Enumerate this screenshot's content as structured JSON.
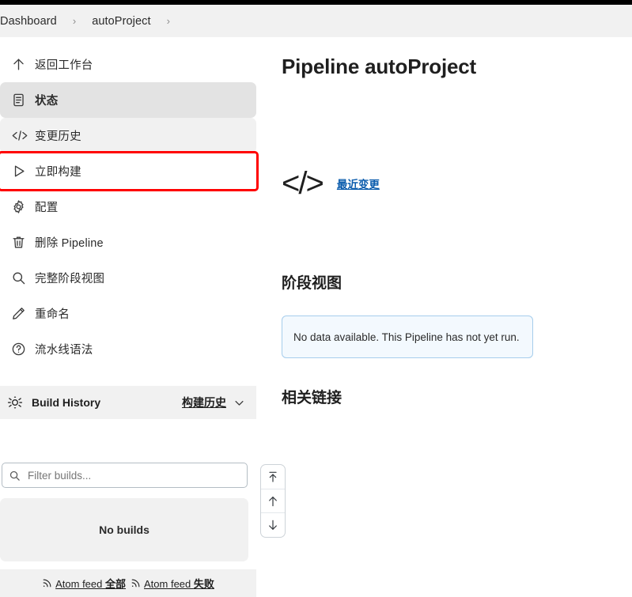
{
  "breadcrumb": {
    "items": [
      {
        "label": "Dashboard"
      },
      {
        "label": "autoProject"
      }
    ],
    "separator": "›"
  },
  "sidebar": {
    "nav_items": [
      {
        "label": "返回工作台",
        "icon": "arrow-up-icon",
        "state": "normal"
      },
      {
        "label": "状态",
        "icon": "document-icon",
        "state": "active"
      },
      {
        "label": "变更历史",
        "icon": "code-icon",
        "state": "soft"
      },
      {
        "label": "立即构建",
        "icon": "play-icon",
        "state": "highlighted"
      },
      {
        "label": "配置",
        "icon": "gear-icon",
        "state": "normal"
      },
      {
        "label": "删除 Pipeline",
        "icon": "trash-icon",
        "state": "normal"
      },
      {
        "label": "完整阶段视图",
        "icon": "search-icon",
        "state": "normal"
      },
      {
        "label": "重命名",
        "icon": "pencil-icon",
        "state": "normal"
      },
      {
        "label": "流水线语法",
        "icon": "question-circle-icon",
        "state": "normal"
      }
    ],
    "build_history": {
      "icon": "build-history-icon",
      "title": "Build History",
      "link_label": "构建历史",
      "chevron": "chevron-down-icon"
    },
    "filter": {
      "icon": "search-icon",
      "placeholder": "Filter builds...",
      "value": ""
    },
    "no_builds_label": "No builds",
    "feeds": [
      {
        "icon": "rss-icon",
        "prefix": "Atom feed ",
        "suffix": "全部"
      },
      {
        "icon": "rss-icon",
        "prefix": "Atom feed ",
        "suffix": "失败"
      }
    ]
  },
  "main": {
    "page_title": "Pipeline autoProject",
    "recent_changes": {
      "icon": "code-icon-large",
      "glyph": "</>",
      "link_label": "最近变更"
    },
    "stage_view": {
      "title": "阶段视图",
      "empty_message": "No data available. This Pipeline has not yet run."
    },
    "related_links": {
      "title": "相关链接"
    }
  },
  "scroll_control": {
    "buttons": [
      {
        "name": "scroll-to-top-button",
        "icon": "arrow-up-to-line-icon"
      },
      {
        "name": "scroll-up-button",
        "icon": "arrow-up-icon"
      },
      {
        "name": "scroll-down-button",
        "icon": "arrow-down-icon"
      }
    ]
  },
  "colors": {
    "highlight_box": "#ff0000",
    "link": "#0b5cad",
    "info_bg": "#f3f9fe",
    "info_border": "#a6cdec",
    "panel_bg": "#f1f1f1",
    "active_bg": "#e3e3e3"
  }
}
